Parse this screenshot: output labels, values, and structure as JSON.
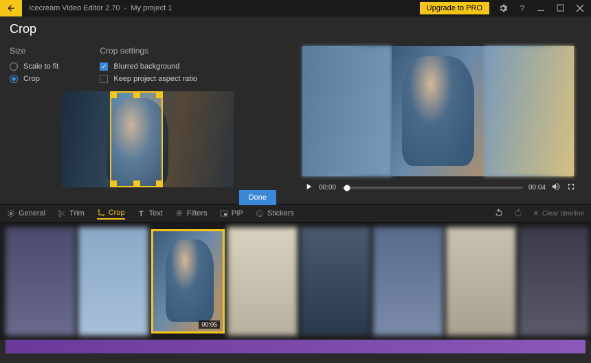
{
  "titlebar": {
    "app_name": "Icecream Video Editor 2.70",
    "separator": "-",
    "project_name": "My project 1",
    "upgrade_label": "Upgrade to PRO"
  },
  "page_title": "Crop",
  "size_group": {
    "title": "Size",
    "scale_label": "Scale to fit",
    "crop_label": "Crop"
  },
  "crop_settings": {
    "title": "Crop settings",
    "blurred_label": "Blurred background",
    "keep_ratio_label": "Keep project aspect ratio",
    "blurred_checked": true,
    "keep_ratio_checked": false
  },
  "done_label": "Done",
  "player": {
    "current_time": "00:00",
    "duration": "00:04"
  },
  "tools": {
    "general": "General",
    "trim": "Trim",
    "crop": "Crop",
    "text": "Text",
    "filters": "Filters",
    "pip": "PiP",
    "stickers": "Stickers",
    "clear_timeline": "Clear timeline"
  },
  "timeline": {
    "selected_duration": "00:05"
  },
  "colors": {
    "accent": "#f5c518",
    "primary_blue": "#3b88d8"
  }
}
